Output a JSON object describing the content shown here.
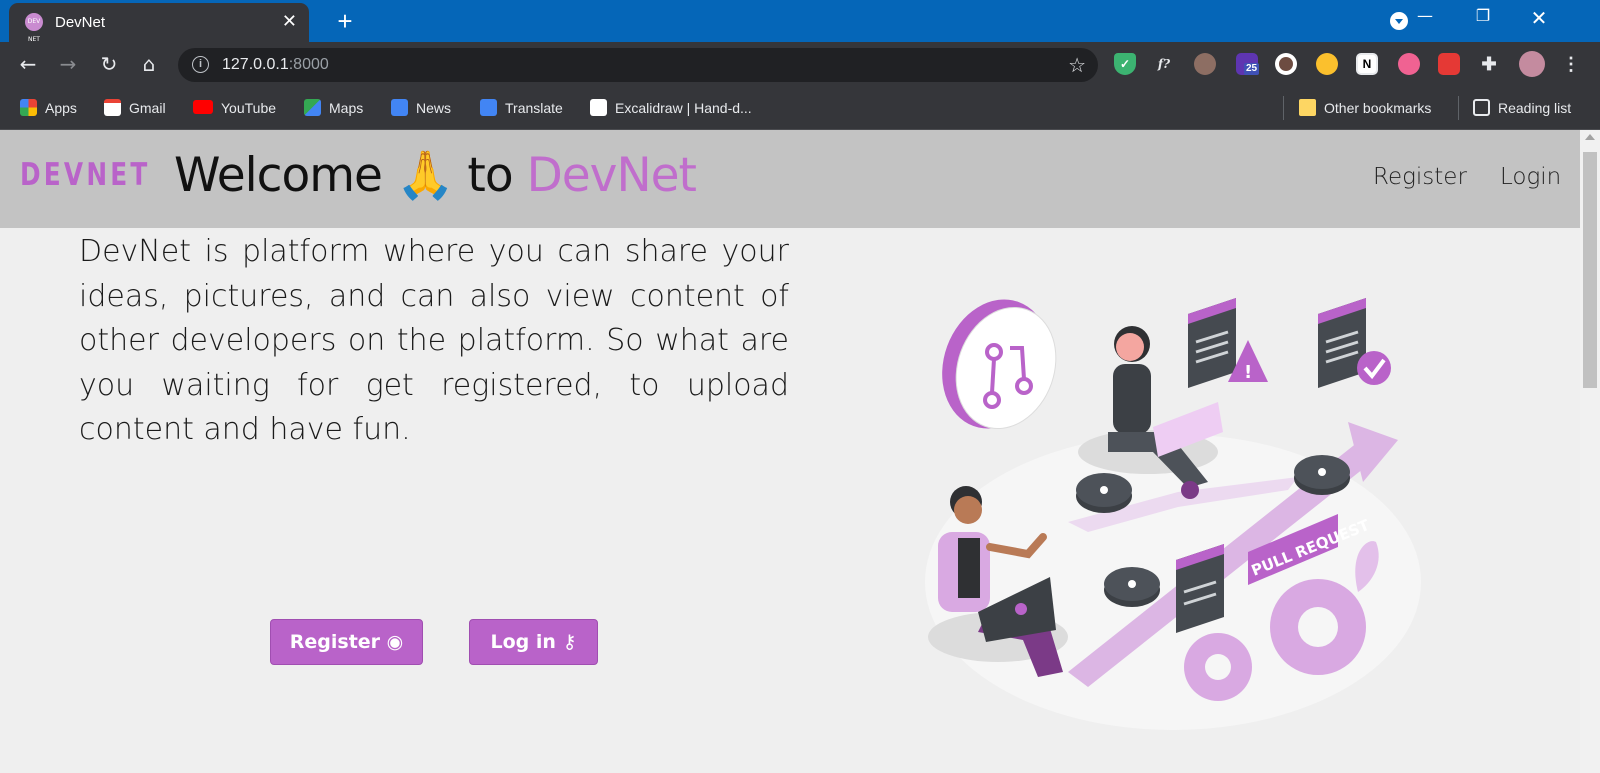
{
  "browser": {
    "tab_title": "DevNet",
    "favicon_text": "DEV NET",
    "url_host": "127.0.0.1",
    "url_port": ":8000",
    "bookmarks": [
      "Apps",
      "Gmail",
      "YouTube",
      "Maps",
      "News",
      "Translate",
      "Excalidraw | Hand-d..."
    ],
    "other_bookmarks": "Other bookmarks",
    "reading_list": "Reading list",
    "extension_badge": "25"
  },
  "navbar": {
    "brand": "DEVNET",
    "register": "Register",
    "login": "Login"
  },
  "hero": {
    "title_pre": "Welcome",
    "title_emoji": "🙏",
    "title_mid": "to",
    "title_accent": "DevNet",
    "description": "DevNet is platform where you can share your ideas, pictures, and can also view content of other developers on the platform. So what are you waiting for get registered, to upload content and have fun.",
    "register_button": "Register",
    "login_button": "Log in",
    "illustration_label": "PULL REQUEST"
  },
  "colors": {
    "accent": "#b963c9",
    "navbar_bg": "#c3c3c3",
    "page_bg": "#efefef",
    "chrome_titlebar": "#0566b8"
  }
}
